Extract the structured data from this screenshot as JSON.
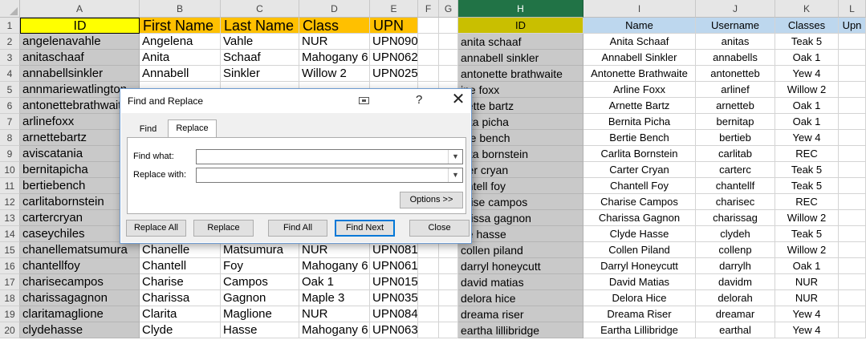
{
  "columns": [
    "A",
    "B",
    "C",
    "D",
    "E",
    "F",
    "G",
    "H",
    "I",
    "J",
    "K",
    "L"
  ],
  "rows": [
    "1",
    "2",
    "3",
    "4",
    "5",
    "6",
    "7",
    "8",
    "9",
    "10",
    "11",
    "12",
    "13",
    "14",
    "15",
    "16",
    "17",
    "18",
    "19",
    "20"
  ],
  "headers": {
    "A": "ID",
    "B": "First Name",
    "C": "Last Name",
    "D": "Class",
    "E": "UPN",
    "H": "ID",
    "I": "Name",
    "J": "Username",
    "K": "Classes",
    "L": "Upn"
  },
  "colA": [
    "angelenavahle",
    "anitaschaaf",
    "annabellsinkler",
    "annmariewatlington",
    "antonettebrathwaite",
    "arlinefoxx",
    "arnettebartz",
    "aviscatania",
    "bernitapicha",
    "bertiebench",
    "carlitabornstein",
    "cartercryan",
    "caseychiles",
    "chanellematsumura",
    "chantellfoy",
    "charisecampos",
    "charissagagnon",
    "claritamaglione",
    "clydehasse"
  ],
  "colsBtoE_top": [
    [
      "Angelena",
      "Vahle",
      "NUR",
      "UPN090"
    ],
    [
      "Anita",
      "Schaaf",
      "Mahogany 6",
      "UPN062"
    ],
    [
      "Annabell",
      "Sinkler",
      "Willow 2",
      "UPN025"
    ]
  ],
  "colsBtoE_bottom": [
    [
      "Chanelle",
      "Matsumura",
      "NUR",
      "UPN081"
    ],
    [
      "Chantell",
      "Foy",
      "Mahogany 6",
      "UPN061"
    ],
    [
      "Charise",
      "Campos",
      "Oak 1",
      "UPN015"
    ],
    [
      "Charissa",
      "Gagnon",
      "Maple 3",
      "UPN035"
    ],
    [
      "Clarita",
      "Maglione",
      "NUR",
      "UPN084"
    ],
    [
      "Clyde",
      "Hasse",
      "Mahogany 6",
      "UPN063"
    ]
  ],
  "colH": [
    "anita schaaf",
    "annabell sinkler",
    "antonette brathwaite",
    "ine foxx",
    "nette bartz",
    "nita picha",
    "rtie bench",
    "rlita bornstein",
    "rter cryan",
    "antell foy",
    "arise campos",
    "arissa gagnon",
    "de hasse",
    "collen piland",
    "darryl honeycutt",
    "david matias",
    "delora hice",
    "dreama riser",
    "eartha lillibridge"
  ],
  "colsItoK": [
    [
      "Anita Schaaf",
      "anitas",
      "Teak 5"
    ],
    [
      "Annabell Sinkler",
      "annabells",
      "Oak 1"
    ],
    [
      "Antonette Brathwaite",
      "antonetteb",
      "Yew 4"
    ],
    [
      "Arline Foxx",
      "arlinef",
      "Willow 2"
    ],
    [
      "Arnette Bartz",
      "arnetteb",
      "Oak 1"
    ],
    [
      "Bernita Picha",
      "bernitap",
      "Oak 1"
    ],
    [
      "Bertie Bench",
      "bertieb",
      "Yew 4"
    ],
    [
      "Carlita Bornstein",
      "carlitab",
      "REC"
    ],
    [
      "Carter Cryan",
      "carterc",
      "Teak 5"
    ],
    [
      "Chantell Foy",
      "chantellf",
      "Teak 5"
    ],
    [
      "Charise Campos",
      "charisec",
      "REC"
    ],
    [
      "Charissa Gagnon",
      "charissag",
      "Willow 2"
    ],
    [
      "Clyde Hasse",
      "clydeh",
      "Teak 5"
    ],
    [
      "Collen Piland",
      "collenp",
      "Willow 2"
    ],
    [
      "Darryl Honeycutt",
      "darrylh",
      "Oak 1"
    ],
    [
      "David Matias",
      "davidm",
      "NUR"
    ],
    [
      "Delora Hice",
      "delorah",
      "NUR"
    ],
    [
      "Dreama Riser",
      "dreamar",
      "Yew 4"
    ],
    [
      "Eartha Lillibridge",
      "earthal",
      "Yew 4"
    ]
  ],
  "dialog": {
    "title": "Find and Replace",
    "help": "?",
    "close": "✕",
    "tab_find": "Find",
    "tab_replace": "Replace",
    "find_label": "Find what:",
    "replace_label": "Replace with:",
    "find_value": "",
    "replace_value": "",
    "options_button": "Options >>",
    "replace_all": "Replace All",
    "replace": "Replace",
    "find_all": "Find All",
    "find_next": "Find Next",
    "close_button": "Close"
  },
  "colors": {
    "selected_header": "#217346",
    "grey_cells": "#c9c9c9",
    "header_yellow": "#ffff00",
    "header_gold": "#ffc000",
    "header_olive": "#c9bf00",
    "header_blue": "#bdd7ee"
  }
}
